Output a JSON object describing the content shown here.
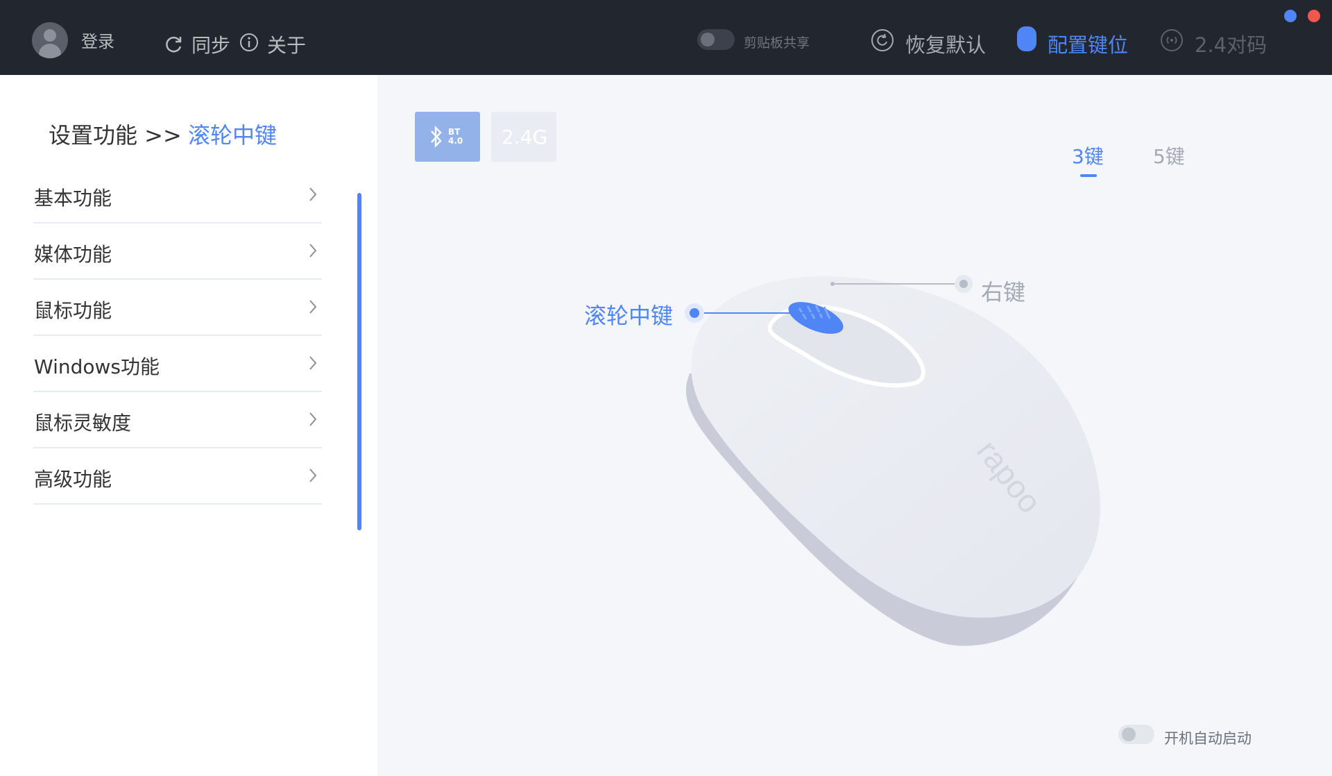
{
  "header": {
    "login_label": "登录",
    "sync_label": "同步",
    "about_label": "关于",
    "clipboard_share_label": "剪贴板共享",
    "clipboard_share_enabled": false,
    "reset_label": "恢复默认",
    "config_label": "配置键位",
    "pair_label": "2.4对码",
    "accent_color": "#4f85f5"
  },
  "sidebar": {
    "breadcrumb_prefix": "设置功能 >>",
    "breadcrumb_current": "滚轮中键",
    "items": [
      {
        "label": "基本功能"
      },
      {
        "label": "媒体功能"
      },
      {
        "label": "鼠标功能"
      },
      {
        "label": "Windows功能"
      },
      {
        "label": "鼠标灵敏度"
      },
      {
        "label": "高级功能"
      }
    ]
  },
  "main": {
    "connection": {
      "bt_label": "BT\n4.0",
      "label_24": "2.4G",
      "selected": "bt"
    },
    "tabs": [
      {
        "label": "3键",
        "active": true
      },
      {
        "label": "5键",
        "active": false
      }
    ],
    "mouse": {
      "brand": "rapoo",
      "scroll_label": "滚轮中键",
      "right_label": "右键",
      "selected_button": "scroll"
    },
    "autostart_label": "开机自动启动",
    "autostart_enabled": false
  }
}
